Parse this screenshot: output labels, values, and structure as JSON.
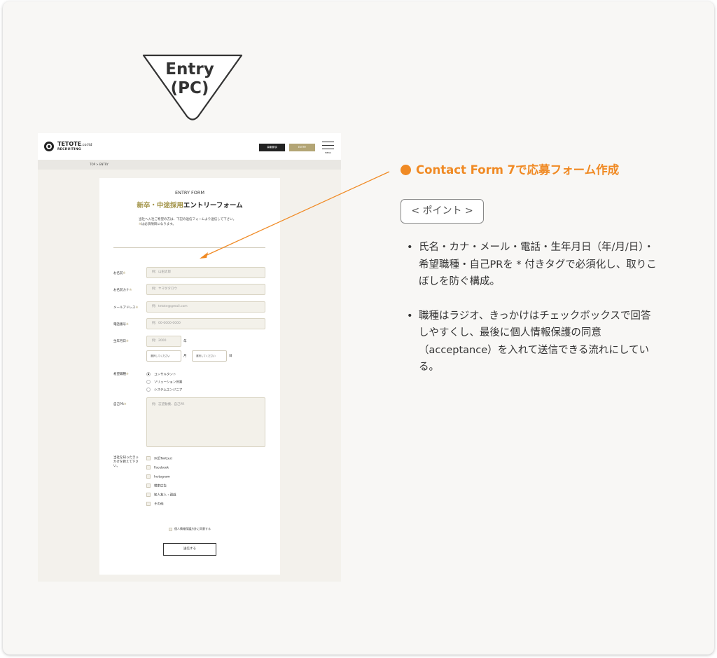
{
  "badge": {
    "line1": "Entry",
    "line2": "(PC)"
  },
  "mock": {
    "logo": {
      "name": "TETOTE",
      "suffix": ".co.ltd",
      "sub": "RECRUITING"
    },
    "header": {
      "recruit_btn": "募集要項",
      "entry_btn": "ENTRY",
      "menu_label": "MENU"
    },
    "breadcrumb": "TOP > ENTRY",
    "form": {
      "kicker": "ENTRY FORM",
      "title_accent": "新卒・中途採用",
      "title_rest": "エントリーフォーム",
      "intro_line1": "当社へ入社ご希望の方は、下記の送信フォームより送信して下さい。",
      "intro_star": "※",
      "intro_line2": "は必須項目になります。",
      "star": "※",
      "fields": {
        "name": {
          "label": "お名前",
          "placeholder": "例：山田太郎"
        },
        "kana": {
          "label": "お名前カナ",
          "placeholder": "例：ヤマダタロウ"
        },
        "email": {
          "label": "メールアドレス",
          "placeholder": "例：tetote@gmail.com"
        },
        "phone": {
          "label": "電話番号",
          "placeholder": "例：00-0000-0000"
        },
        "birth": {
          "label": "生年月日",
          "year_placeholder": "例：2000",
          "year_unit": "年",
          "month_select": "選択してください",
          "month_unit": "月",
          "day_select": "選択してください",
          "day_unit": "日"
        },
        "job": {
          "label": "希望職種",
          "options": [
            "コンサルタント",
            "ソリューション営業",
            "システムエンジニア"
          ],
          "selected": 0
        },
        "pr": {
          "label": "自己PR",
          "placeholder": "例：志望動機、自己PR"
        },
        "source": {
          "label": "当社を知ったきっかけを教えて下さい。",
          "options": [
            "X(旧Twitter)",
            "Facebook",
            "Instagram",
            "検索広告",
            "知人友人・親戚",
            "その他"
          ]
        }
      },
      "agree": "個人情報保護方針に同意する",
      "submit": "送信する"
    }
  },
  "notes": {
    "heading": "Contact Form 7で応募フォーム作成",
    "point_label": "< ポイント >",
    "bullets": [
      "氏名・カナ・メール・電話・生年月日（年/月/日）・希望職種・自己PRを * 付きタグで必須化し、取りこぼしを防ぐ構成。",
      "職種はラジオ、きっかけはチェックボックスで回答しやすくし、最後に個人情報保護の同意（acceptance）を入れて送信できる流れにしている。"
    ]
  },
  "colors": {
    "accent": "#f08a24",
    "gold": "#b3a575",
    "card_bg": "#f8f7f5"
  }
}
